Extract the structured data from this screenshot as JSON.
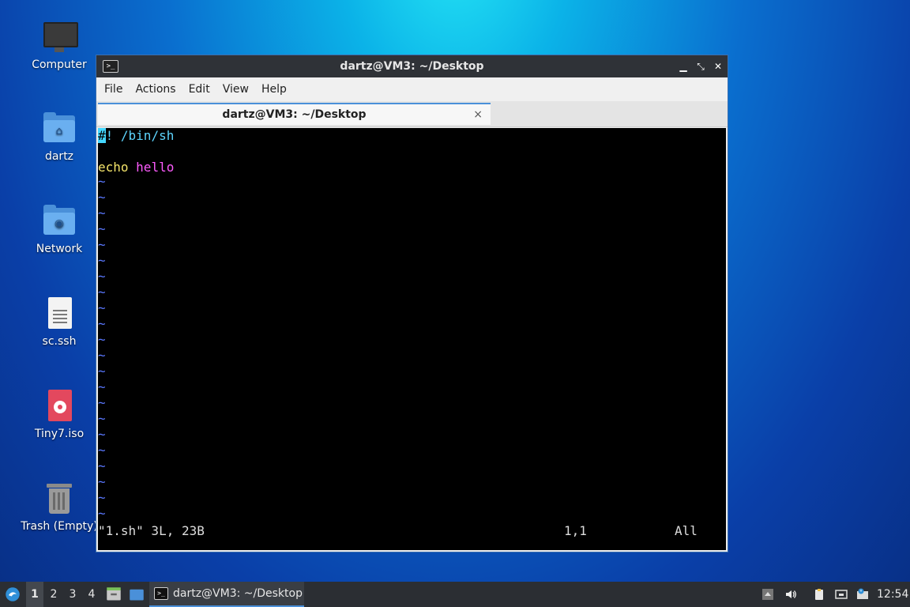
{
  "desktop": {
    "icons": [
      {
        "label": "Computer"
      },
      {
        "label": "dartz"
      },
      {
        "label": "Network"
      },
      {
        "label": "sc.ssh"
      },
      {
        "label": "Tiny7.iso"
      },
      {
        "label": "Trash (Empty)"
      }
    ]
  },
  "window": {
    "title": "dartz@VM3: ~/Desktop",
    "menu": [
      "File",
      "Actions",
      "Edit",
      "View",
      "Help"
    ],
    "tab": {
      "label": "dartz@VM3: ~/Desktop",
      "close": "×"
    },
    "controls": {
      "minimize": "▁",
      "maximize": "⤡",
      "close": "✕"
    }
  },
  "terminal": {
    "line1_cursor": "#",
    "line1_rest": "! /bin/sh",
    "line3_cmd": "echo",
    "line3_arg": "hello",
    "tilde": "~",
    "status_file": "\"1.sh\" 3L, 23B",
    "status_pos": "1,1",
    "status_scroll": "All"
  },
  "taskbar": {
    "workspaces": [
      "1",
      "2",
      "3",
      "4"
    ],
    "task_label": "dartz@VM3: ~/Desktop",
    "clock": "12:54"
  },
  "colors": {
    "accent": "#4a90d9"
  }
}
